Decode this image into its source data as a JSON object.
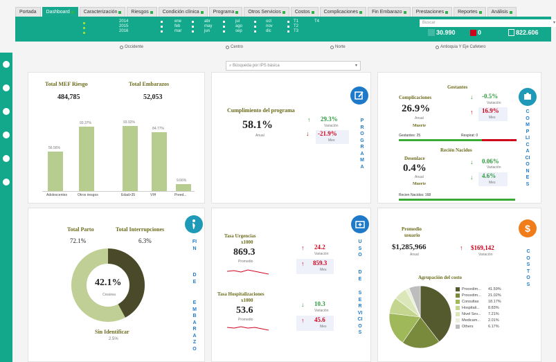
{
  "tabs": [
    {
      "label": "Portada",
      "active": false,
      "sq": false
    },
    {
      "label": "Dashboard",
      "active": true,
      "sq": true
    },
    {
      "label": "Caracterización",
      "active": false,
      "sq": true
    },
    {
      "label": "Riesgos",
      "active": false,
      "sq": true
    },
    {
      "label": "Condición clínica",
      "active": false,
      "sq": true
    },
    {
      "label": "Programa",
      "active": false,
      "sq": true
    },
    {
      "label": "Otros Servicios",
      "active": false,
      "sq": true
    },
    {
      "label": "Costos",
      "active": false,
      "sq": true
    },
    {
      "label": "Complicaciones",
      "active": false,
      "sq": true
    },
    {
      "label": "Fin Embarazo",
      "active": false,
      "sq": true
    },
    {
      "label": "Prestaciones",
      "active": false,
      "sq": true
    },
    {
      "label": "Reportes",
      "active": false,
      "sq": true
    },
    {
      "label": "Análisis",
      "active": false,
      "sq": true
    }
  ],
  "header": {
    "years": [
      "2014",
      "2015",
      "2016"
    ],
    "months1": [
      "ene",
      "feb",
      "mar"
    ],
    "months2": [
      "abr",
      "may",
      "jun"
    ],
    "months3": [
      "jul",
      "ago",
      "sep"
    ],
    "months4": [
      "oct",
      "nov",
      "dic"
    ],
    "trims": [
      "T1",
      "T2",
      "T3"
    ],
    "t4": "T4",
    "search_placeholder": "Buscar",
    "kpi1": "30.990",
    "kpi2": "0",
    "kpi3": "822.606"
  },
  "radios": {
    "r1": "Occidente",
    "r2": "Centro",
    "r3": "Norte",
    "r4": "Antioquia Y Eje Cafetero"
  },
  "ips_search": "Búsqueda por IPS básica",
  "riesgo": {
    "mef_label": "Total MEF Riesgo",
    "mef_value": "484,785",
    "emb_label": "Total Embarazos",
    "emb_value": "52,053",
    "bars": [
      {
        "label": "Adolescentes",
        "pct": "56.56%",
        "value": 56.56
      },
      {
        "label": "Otros riesgos",
        "pct": "93.37%",
        "value": 93.37
      },
      {
        "label": "Edad>35",
        "pct": "93.92%",
        "value": 93.92
      },
      {
        "label": "VIH",
        "pct": "84.77%",
        "value": 84.77
      },
      {
        "label": "Preed...",
        "pct": "9.66%",
        "value": 9.66
      }
    ]
  },
  "programa": {
    "label": "Cumplimiento del programa",
    "value": "58.1%",
    "sub": "Anual",
    "up": "29.3%",
    "up_sub": "Variación",
    "down": "-21.9%",
    "down_sub": "Mes",
    "vert": "PROGRAMA"
  },
  "complicaciones": {
    "gestantes": "Gestantes",
    "comp_label": "Complicaciones",
    "comp_value": "26.9%",
    "anual": "Anual",
    "v1": "-0.5%",
    "v1_sub": "Variación",
    "v2": "16.9%",
    "v2_sub": "Mes",
    "muerte": "Muerte",
    "gest_bar": "Gestantes: 25",
    "resp_bar": "Respirat: 0",
    "recien": "Recién Nacidos",
    "desenlace": "Desenlace",
    "des_value": "0.4%",
    "v3": "0.06%",
    "v3_sub": "Variación",
    "v4": "4.6%",
    "v4_sub": "Mes",
    "muerte2": "Muerte",
    "rn_bar": "Recien Nacidos: 168",
    "vert": "COMPLICACIONES"
  },
  "fin": {
    "parto_label": "Total Parto",
    "parto_value": "72.1%",
    "int_label": "Total Interrupciones",
    "int_value": "6.3%",
    "center": "42.1%",
    "center_sub": "Cesárea",
    "sin_label": "Sin Identificar",
    "sin_value": "2.5%",
    "vert1": "FIN",
    "vert2": "DE",
    "vert3": "EMBARAZO"
  },
  "uso": {
    "urg_label1": "Tasa Urgencias",
    "urg_label2": "x1000",
    "urg_value": "869.3",
    "urg_sub": "Promedio",
    "urg_v1": "24.2",
    "urg_v1_sub": "Variación",
    "urg_v2": "859.3",
    "urg_v2_sub": "Mes",
    "hos_label1": "Tasa Hospitalizaciones",
    "hos_label2": "x1000",
    "hos_value": "53.6",
    "hos_sub": "Promedio",
    "hos_v1": "10.3",
    "hos_v1_sub": "Variación",
    "hos_v2": "45.6",
    "hos_v2_sub": "Mes",
    "vert1": "USO",
    "vert2": "DE",
    "vert3": "SERVICIOS"
  },
  "costos": {
    "label1": "Promedio",
    "label2": "usuario",
    "value": "$1,285,966",
    "sub": "Anual",
    "var": "$169,142",
    "var_sub": "Variación",
    "agrup": "Agrupación del costo",
    "vert": "COSTOS"
  },
  "chart_data": {
    "type": "pie",
    "title": "Agrupación del costo",
    "categories": [
      "Procedim...",
      "Procedim...",
      "Consultas",
      "Hospitali...",
      "Nivel Sev...",
      "Medicam...",
      "Others"
    ],
    "values": [
      41.59,
      21.02,
      18.17,
      8.83,
      7.21,
      2.01,
      6.17
    ],
    "labels": [
      "41.59%",
      "21.02%",
      "18.17%",
      "8.83%",
      "7.21%",
      "2.01%",
      "6.17%"
    ],
    "colors": [
      "#555a2e",
      "#7a8a3c",
      "#9fb85a",
      "#c3d58f",
      "#dce7b9",
      "#e9efd8",
      "#bdbdbd"
    ]
  }
}
